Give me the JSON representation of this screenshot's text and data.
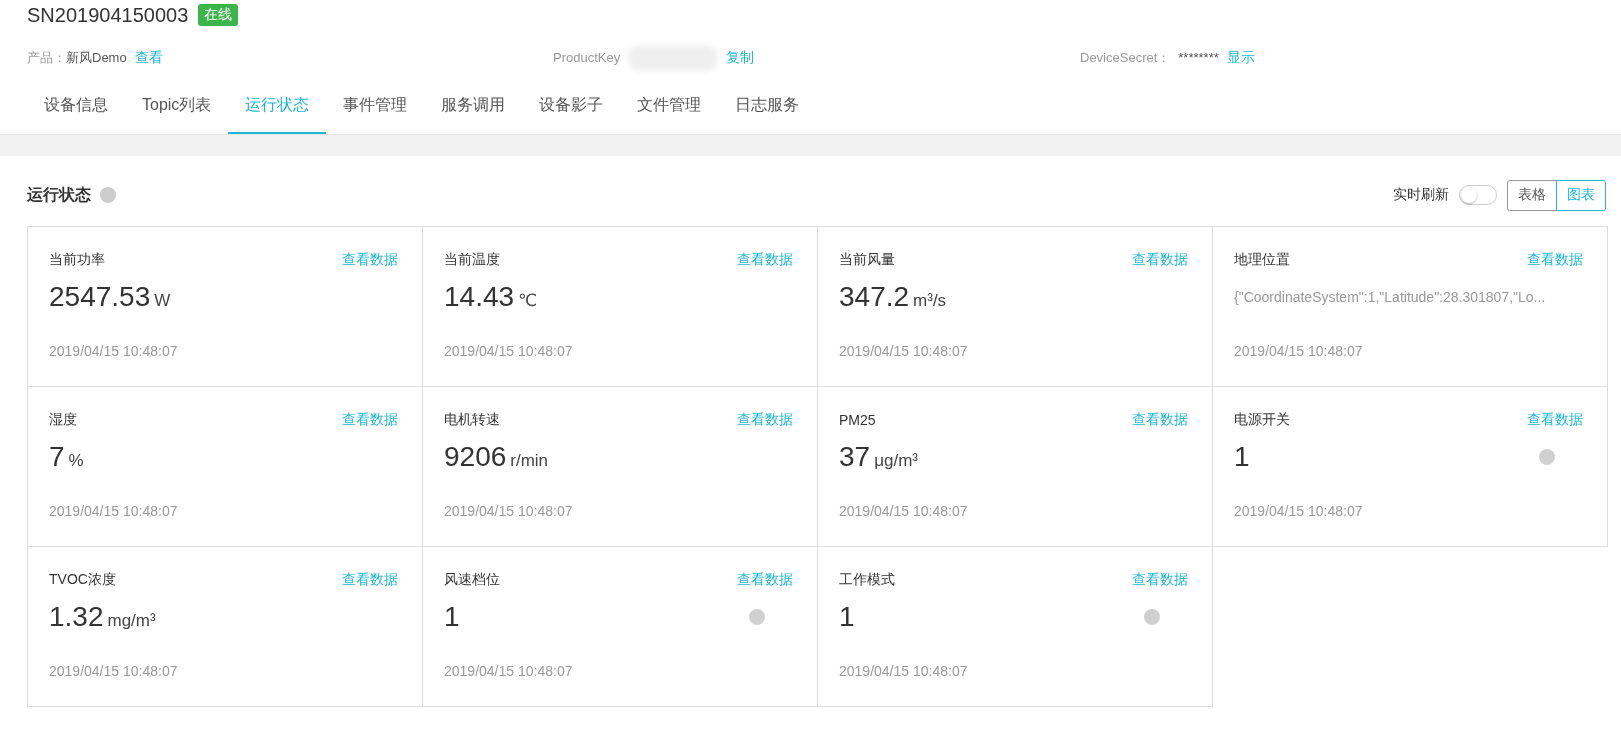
{
  "device": {
    "serial": "SN201904150003",
    "status": "在线",
    "online": true
  },
  "info": {
    "product_label": "产品：",
    "product_name": "新风Demo",
    "product_link": "查看",
    "product_key_label": "ProductKey",
    "product_key_redacted": true,
    "copy_link": "复制",
    "secret_label": "DeviceSecret：",
    "secret_value": "********",
    "show_link": "显示"
  },
  "tabs": [
    {
      "label": "设备信息",
      "selected": false
    },
    {
      "label": "Topic列表",
      "selected": false
    },
    {
      "label": "运行状态",
      "selected": true
    },
    {
      "label": "事件管理",
      "selected": false
    },
    {
      "label": "服务调用",
      "selected": false
    },
    {
      "label": "设备影子",
      "selected": false
    },
    {
      "label": "文件管理",
      "selected": false
    },
    {
      "label": "日志服务",
      "selected": false
    }
  ],
  "panel": {
    "title": "运行状态",
    "realtime_label": "实时刷新",
    "realtime_on": false,
    "views": [
      {
        "label": "表格",
        "selected": false
      },
      {
        "label": "图表",
        "selected": true
      }
    ]
  },
  "cards": [
    {
      "kind": "metric",
      "name": "当前功率",
      "link": "查看数据",
      "value": "2547.53",
      "unit": "W",
      "time": "2019/04/15 10:48:07",
      "info_icon": false
    },
    {
      "kind": "metric",
      "name": "当前温度",
      "link": "查看数据",
      "value": "14.43",
      "unit": "℃",
      "time": "2019/04/15 10:48:07",
      "info_icon": false
    },
    {
      "kind": "metric",
      "name": "当前风量",
      "link": "查看数据",
      "value": "347.2",
      "unit": "m³/s",
      "time": "2019/04/15 10:48:07",
      "info_icon": false
    },
    {
      "kind": "text",
      "name": "地理位置",
      "link": "查看数据",
      "value": "{\"CoordinateSystem\":1,\"Latitude\":28.301807,\"Lo...",
      "time": "2019/04/15 10:48:07",
      "info_icon": false
    },
    {
      "kind": "metric",
      "name": "湿度",
      "link": "查看数据",
      "value": "7",
      "unit": "%",
      "time": "2019/04/15 10:48:07",
      "info_icon": false
    },
    {
      "kind": "metric",
      "name": "电机转速",
      "link": "查看数据",
      "value": "9206",
      "unit": "r/min",
      "time": "2019/04/15 10:48:07",
      "info_icon": false
    },
    {
      "kind": "metric",
      "name": "PM25",
      "link": "查看数据",
      "value": "37",
      "unit": "μg/m³",
      "time": "2019/04/15 10:48:07",
      "info_icon": false
    },
    {
      "kind": "metric",
      "name": "电源开关",
      "link": "查看数据",
      "value": "1",
      "time": "2019/04/15 10:48:07",
      "info_icon": true
    },
    {
      "kind": "metric",
      "name": "TVOC浓度",
      "link": "查看数据",
      "value": "1.32",
      "unit": "mg/m³",
      "time": "2019/04/15 10:48:07",
      "info_icon": false
    },
    {
      "kind": "metric",
      "name": "风速档位",
      "link": "查看数据",
      "value": "1",
      "time": "2019/04/15 10:48:07",
      "info_icon": true
    },
    {
      "kind": "metric",
      "name": "工作模式",
      "link": "查看数据",
      "value": "1",
      "time": "2019/04/15 10:48:07",
      "info_icon": true
    }
  ]
}
